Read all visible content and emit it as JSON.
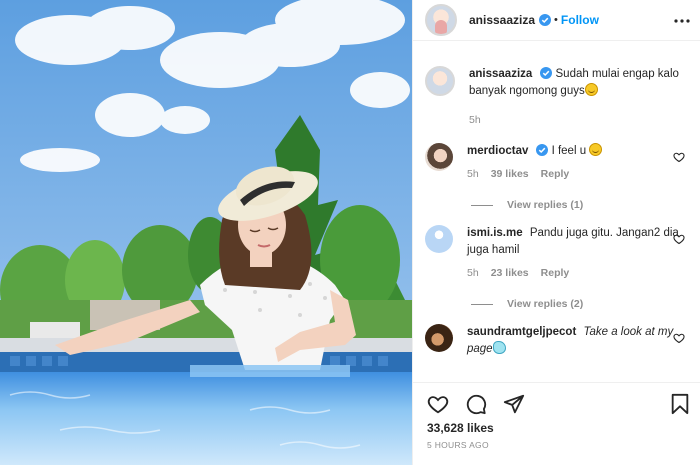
{
  "header": {
    "username": "anissaaziza",
    "separator": "•",
    "follow_label": "Follow"
  },
  "caption": {
    "username": "anissaaziza",
    "text": "Sudah mulai engap kalo banyak ngomong guys",
    "time": "5h"
  },
  "comments": [
    {
      "username": "merdioctav",
      "verified": true,
      "text": "I feel u",
      "time": "5h",
      "likes": "39 likes",
      "reply_label": "Reply",
      "view_replies": "View replies (1)"
    },
    {
      "username": "ismi.is.me",
      "text": "Pandu juga gitu. Jangan2 dia juga hamil",
      "time": "5h",
      "likes": "23 likes",
      "reply_label": "Reply",
      "view_replies": "View replies (2)"
    },
    {
      "username": "saundramtgeljpecot",
      "text": "Take a look at my page"
    }
  ],
  "footer": {
    "likes": "33,628 likes",
    "time": "5 HOURS AGO"
  },
  "colors": {
    "accent": "#0095f6",
    "verified": "#3897f0",
    "muted": "#8e8e8e"
  }
}
